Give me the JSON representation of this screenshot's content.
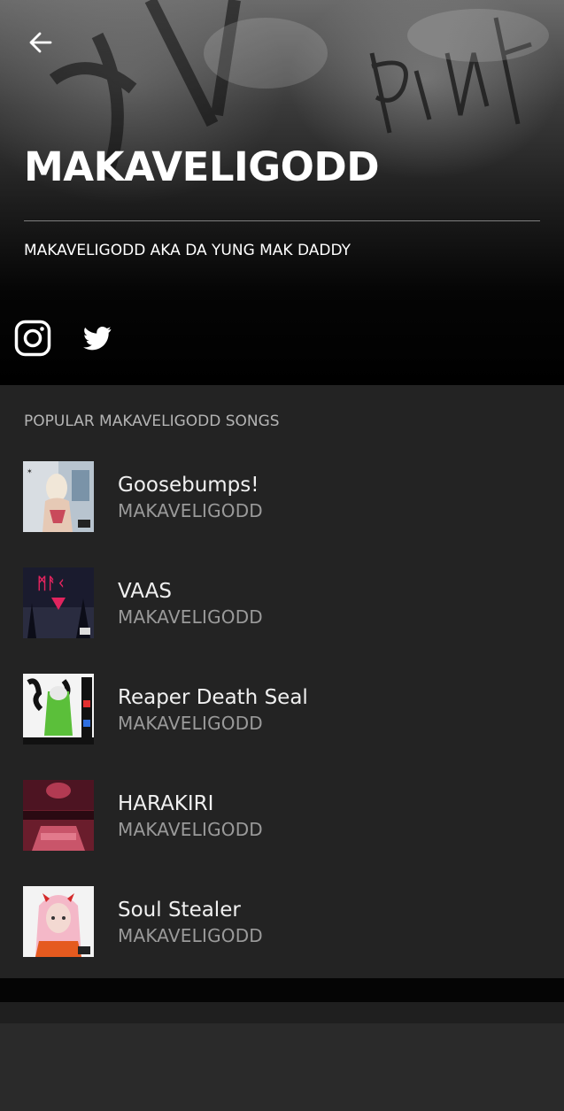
{
  "header": {
    "artist_name": "MAKAVELIGODD",
    "tagline": "MAKAVELIGODD AKA DA YUNG MAK DADDY",
    "back_icon": "arrow-left-icon",
    "social": [
      {
        "name": "instagram",
        "icon": "instagram-icon"
      },
      {
        "name": "twitter",
        "icon": "twitter-icon"
      }
    ]
  },
  "popular": {
    "heading": "POPULAR MAKAVELIGODD SONGS",
    "songs": [
      {
        "title": "Goosebumps!",
        "artist": "MAKAVELIGODD"
      },
      {
        "title": "VAAS",
        "artist": "MAKAVELIGODD"
      },
      {
        "title": "Reaper Death Seal",
        "artist": "MAKAVELIGODD"
      },
      {
        "title": "HARAKIRI",
        "artist": "MAKAVELIGODD"
      },
      {
        "title": "Soul Stealer",
        "artist": "MAKAVELIGODD"
      }
    ]
  },
  "colors": {
    "hero_bg": "#000000",
    "list_bg": "#232323",
    "title_text": "#f0f0f0",
    "secondary_text": "#9a9a9a",
    "heading_text": "#b4b4b4"
  }
}
